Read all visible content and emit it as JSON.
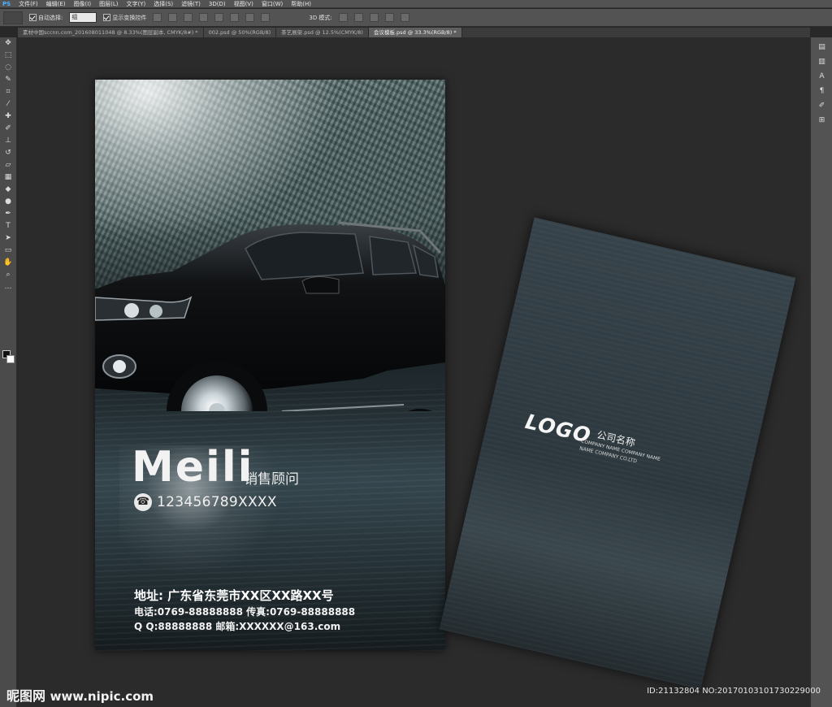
{
  "menubar": {
    "app_icon": "PS",
    "items": [
      "文件(F)",
      "编辑(E)",
      "图像(I)",
      "图层(L)",
      "文字(Y)",
      "选择(S)",
      "滤镜(T)",
      "3D(D)",
      "视图(V)",
      "窗口(W)",
      "帮助(H)"
    ]
  },
  "options_bar": {
    "auto_select_label": "自动选择:",
    "auto_select_value": "组",
    "show_transform_label": "显示变换控件",
    "mode_3d_label": "3D 模式:"
  },
  "tabs": [
    {
      "label": "素材中国sccnn.com_20160801104​8 @ 8.33%(图层副本, CMYK/8#) *",
      "active": false
    },
    {
      "label": "002.psd @ 50%(RGB/8)",
      "active": false
    },
    {
      "label": "茶艺展架.psd @ 12.5%(CMYK/8)",
      "active": false
    },
    {
      "label": "会议模板.psd @ 33.3%(RGB/8) *",
      "active": true
    }
  ],
  "front_card": {
    "name": "Meili",
    "title": "销售顾问",
    "phone": "123456789XXXX",
    "address": "地址: 广东省东莞市XX区XX路XX号",
    "tel_fax": "电话:0769-88888888  传真:0769-88888888",
    "qq_email": "Q Q:88888888  邮箱:XXXXXX@163.com"
  },
  "back_card": {
    "logo": "LOGO",
    "company_cn": "公司名称",
    "company_en_1": "COMPANY NAME COMPANY NAME",
    "company_en_2": "NAME COMPANY CO.LTD"
  },
  "watermark": {
    "site_cn": "昵图网",
    "site_url": "www.nipic.com",
    "id_text": "ID:21132804 NO:20170103101730229000"
  },
  "colors": {
    "app_chrome": "#535353",
    "canvas_bg": "#2b2b2b",
    "card_dark": "#2c383e"
  }
}
